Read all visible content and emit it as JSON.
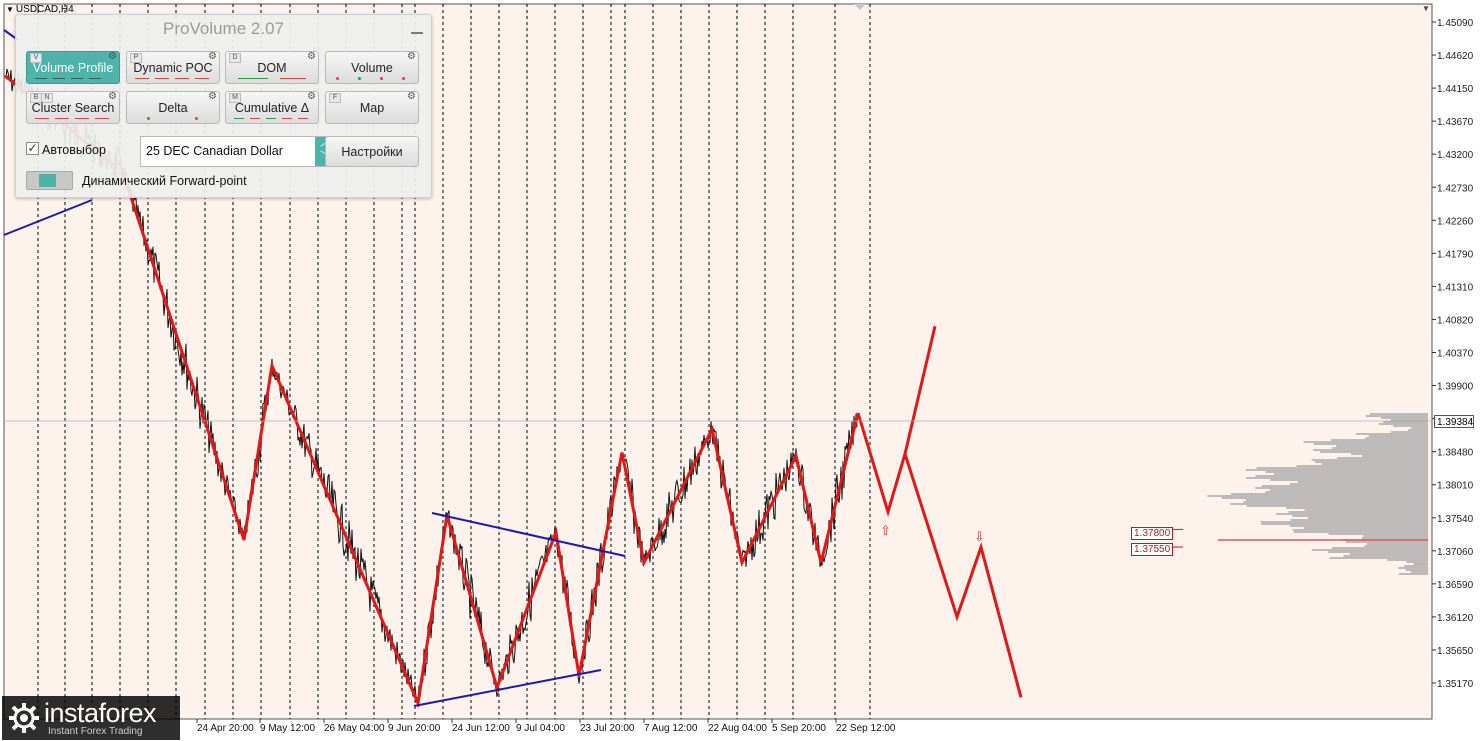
{
  "symbol": {
    "label": "USDCAD,H4"
  },
  "colors": {
    "background": "#fdf3ec",
    "zigzag": "#e01818",
    "trendline": "#1a1ab0",
    "accent": "#4fb3aa",
    "price_line": "#111111",
    "profile": "#a8a8a8"
  },
  "panel": {
    "title": "ProVolume 2.07",
    "buttons": [
      {
        "label": "Volume Profile",
        "active": true,
        "hotkeys": [
          "V"
        ]
      },
      {
        "label": "Dynamic POC",
        "active": false,
        "hotkeys": [
          "P"
        ]
      },
      {
        "label": "DOM",
        "active": false,
        "hotkeys": [
          "D"
        ]
      },
      {
        "label": "Volume",
        "active": false,
        "hotkeys": []
      },
      {
        "label": "Cluster Search",
        "active": false,
        "hotkeys": [
          "B",
          "N"
        ]
      },
      {
        "label": "Delta",
        "active": false,
        "hotkeys": []
      },
      {
        "label": "Cumulative Δ",
        "active": false,
        "hotkeys": [
          "M"
        ]
      },
      {
        "label": "Map",
        "active": false,
        "hotkeys": [
          "F"
        ]
      }
    ],
    "autoselect_label": "Автовыбор",
    "autoselect_checked": true,
    "instrument_value": "25 DEC Canadian Dollar",
    "settings_label": "Настройки",
    "forward_point_label": "Динамический Forward-point"
  },
  "price_axis": [
    "1.45090",
    "1.44620",
    "1.44150",
    "1.43670",
    "1.43200",
    "1.42730",
    "1.42260",
    "1.41790",
    "1.41310",
    "1.40820",
    "1.40370",
    "1.39900",
    "1.39384",
    "1.38950",
    "1.38480",
    "1.38010",
    "1.37540",
    "1.37060",
    "1.36590",
    "1.36120",
    "1.35650",
    "1.35170"
  ],
  "current_price": "1.39384",
  "time_axis": [
    "24 Apr 20:00",
    "9 May 12:00",
    "26 May 04:00",
    "9 Jun 20:00",
    "24 Jun 12:00",
    "9 Jul 04:00",
    "23 Jul 20:00",
    "7 Aug 12:00",
    "22 Aug 04:00",
    "5 Sep 20:00",
    "22 Sep 12:00"
  ],
  "level_labels": [
    "1.37800",
    "1.37550"
  ],
  "logo": {
    "brand": "instaforex",
    "tagline": "Instant Forex Trading"
  },
  "chart_data": {
    "type": "line",
    "symbol": "USDCAD",
    "timeframe": "H4",
    "ylim": [
      1.3517,
      1.4509
    ],
    "x": [
      "24 Apr 20:00",
      "9 May 12:00",
      "26 May 04:00",
      "9 Jun 20:00",
      "24 Jun 12:00",
      "9 Jul 04:00",
      "23 Jul 20:00",
      "7 Aug 12:00",
      "22 Aug 04:00",
      "5 Sep 20:00",
      "22 Sep 12:00"
    ],
    "zigzag_pivots": [
      1.4423,
      1.4298,
      1.4298,
      1.3765,
      1.4012,
      1.3534,
      1.38,
      1.3556,
      1.3776,
      1.3573,
      1.3889,
      1.3733,
      1.3922,
      1.3733,
      1.3884,
      1.3733,
      1.3945
    ],
    "forecast_pivots": [
      1.3945,
      1.3805,
      1.3887,
      1.4068,
      1.3887,
      1.3656,
      1.3755,
      1.3542
    ],
    "levels": [
      1.378,
      1.3755
    ],
    "current_price": 1.39384,
    "grid": true
  }
}
